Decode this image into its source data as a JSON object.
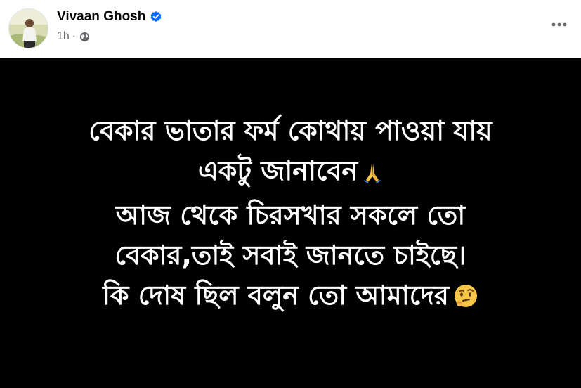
{
  "post": {
    "author": "Vivaan Ghosh",
    "verified": true,
    "time": "1h",
    "separator": "·",
    "audience_icon": "globe-icon",
    "more_icon": "more-options-icon",
    "lines": [
      "বেকার ভাতার ফর্ম কোথায় পাওয়া যায়",
      "একটু জানাবেন",
      "আজ থেকে চিরসখার সকলে তো",
      "বেকার,তাই সবাই জানতে চাইছে।",
      "কি দোষ ছিল বলুন তো আমাদের"
    ],
    "emojis": {
      "line_2": "folded-hands-emoji",
      "line_5": "thinking-face-emoji"
    }
  },
  "colors": {
    "background_card": "#000000",
    "text_on_card": "#ffffff",
    "verified_badge": "#0866ff",
    "meta_text": "#65676b",
    "name_text": "#050505"
  }
}
